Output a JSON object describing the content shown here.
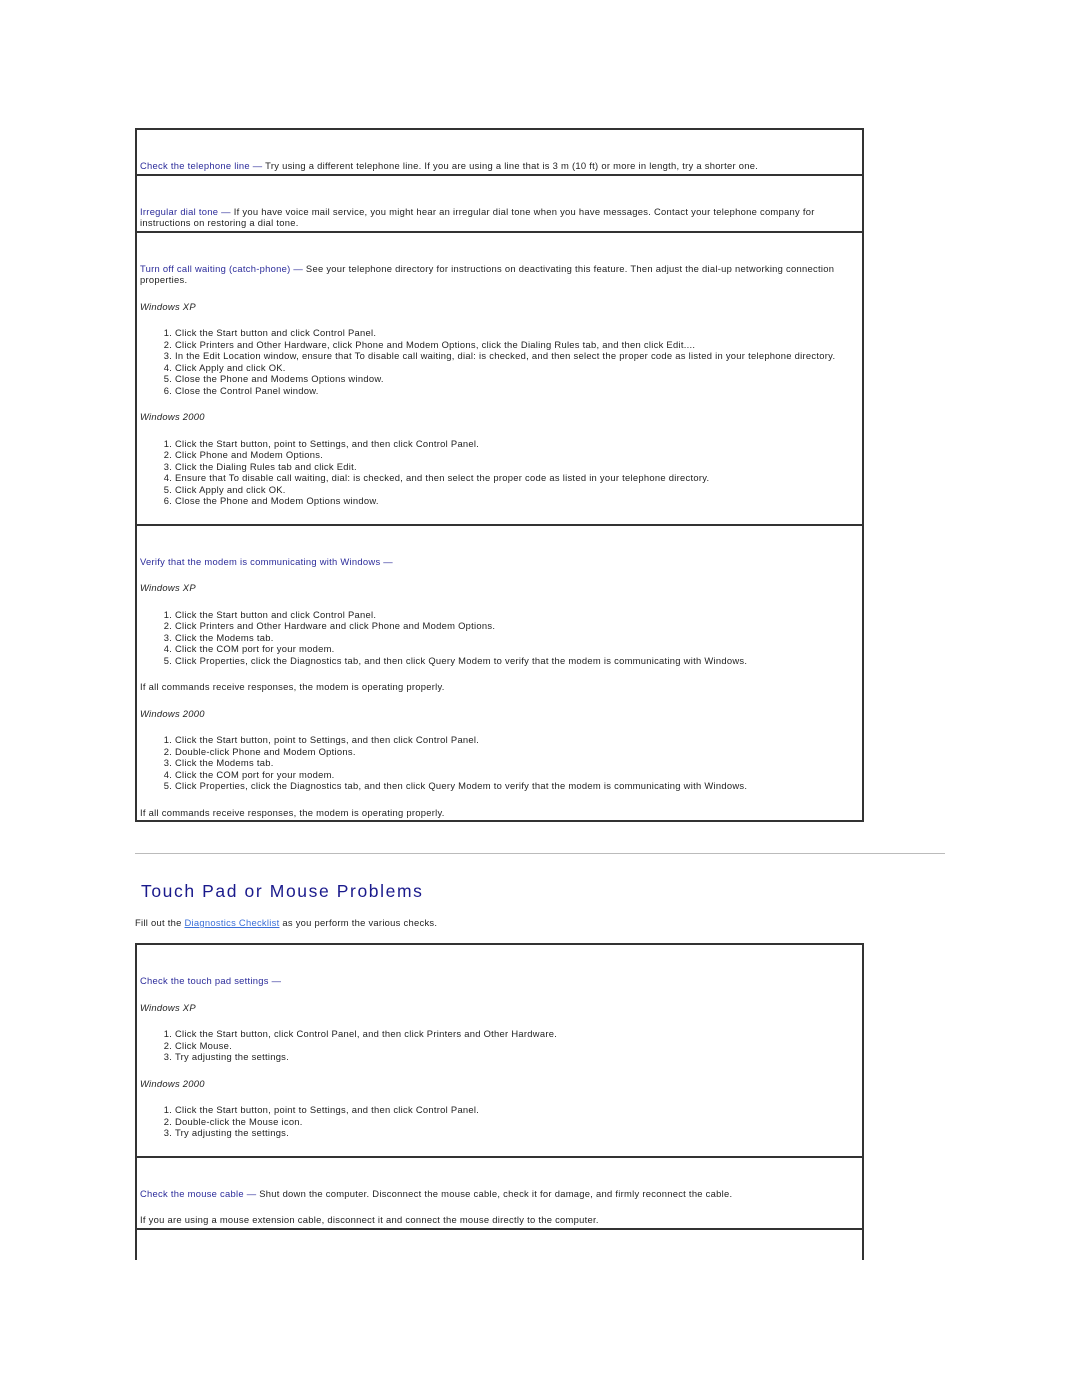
{
  "modem_table": {
    "telephone_line": {
      "heading": "Check the telephone line —",
      "text": " Try using a different telephone line. If you are using a line that is 3 m (10 ft) or more in length, try a shorter one."
    },
    "dial_tone": {
      "heading": "Irregular dial tone —",
      "text": " If you have voice mail service, you might hear an irregular dial tone when you have messages. Contact your telephone company for instructions on restoring a dial tone."
    },
    "call_waiting": {
      "heading": "Turn off call waiting (catch-phone) —",
      "text": " See your telephone directory for instructions on deactivating this feature. Then adjust the dial-up networking connection properties.",
      "xp_label": "Windows XP",
      "xp_steps": [
        "Click the Start button and click Control Panel.",
        "Click Printers and Other Hardware, click Phone and Modem Options, click the Dialing Rules tab, and then click Edit....",
        "In the Edit Location window, ensure that To disable call waiting, dial: is checked, and then select the proper code as listed in your telephone directory.",
        "Click Apply and click OK.",
        "Close the Phone and Modems Options window.",
        "Close the Control Panel window."
      ],
      "w2k_label": "Windows 2000",
      "w2k_steps": [
        "Click the Start button, point to Settings, and then click Control Panel.",
        "Click Phone and Modem Options.",
        "Click the Dialing Rules tab and click Edit.",
        "Ensure that To disable call waiting, dial: is checked, and then select the proper code as listed in your telephone directory.",
        "Click Apply and click OK.",
        "Close the Phone and Modem Options window."
      ]
    },
    "verify_modem": {
      "heading": "Verify that the modem is communicating with Windows —",
      "xp_label": "Windows XP",
      "xp_steps": [
        "Click the Start button and click Control Panel.",
        "Click Printers and Other Hardware and click Phone and Modem Options.",
        "Click the Modems tab.",
        "Click the COM port for your modem.",
        "Click Properties, click the Diagnostics tab, and then click Query Modem to verify that the modem is communicating with Windows."
      ],
      "xp_result": "If all commands receive responses, the modem is operating properly.",
      "w2k_label": "Windows 2000",
      "w2k_steps": [
        "Click the Start button, point to Settings, and then click Control Panel.",
        "Double-click Phone and Modem Options.",
        "Click the Modems tab.",
        "Click the COM port for your modem.",
        "Click Properties, click the Diagnostics tab, and then click Query Modem to verify that the modem is communicating with Windows."
      ],
      "w2k_result": "If all commands receive responses, the modem is operating properly."
    }
  },
  "section": {
    "title": "Touch Pad or Mouse Problems",
    "intro_before": "Fill out the ",
    "intro_link": "Diagnostics Checklist",
    "intro_after": " as you perform the various checks."
  },
  "mouse_table": {
    "touch_pad": {
      "heading": "Check the touch pad settings —",
      "xp_label": "Windows XP",
      "xp_steps": [
        "Click the Start button, click Control Panel, and then click Printers and Other Hardware.",
        "Click Mouse.",
        "Try adjusting the settings."
      ],
      "w2k_label": "Windows 2000",
      "w2k_steps": [
        "Click the Start button, point to Settings, and then click Control Panel.",
        "Double-click the Mouse icon.",
        "Try adjusting the settings."
      ]
    },
    "mouse_cable": {
      "heading": "Check the mouse cable —",
      "text": " Shut down the computer. Disconnect the mouse cable, check it for damage, and firmly reconnect the cable.",
      "extension": "If you are using a mouse extension cable, disconnect it and connect the mouse directly to the computer."
    }
  },
  "colors": {
    "heading": "#2b2b9a",
    "title": "#1a1a8c",
    "link": "#3a6fd8"
  }
}
